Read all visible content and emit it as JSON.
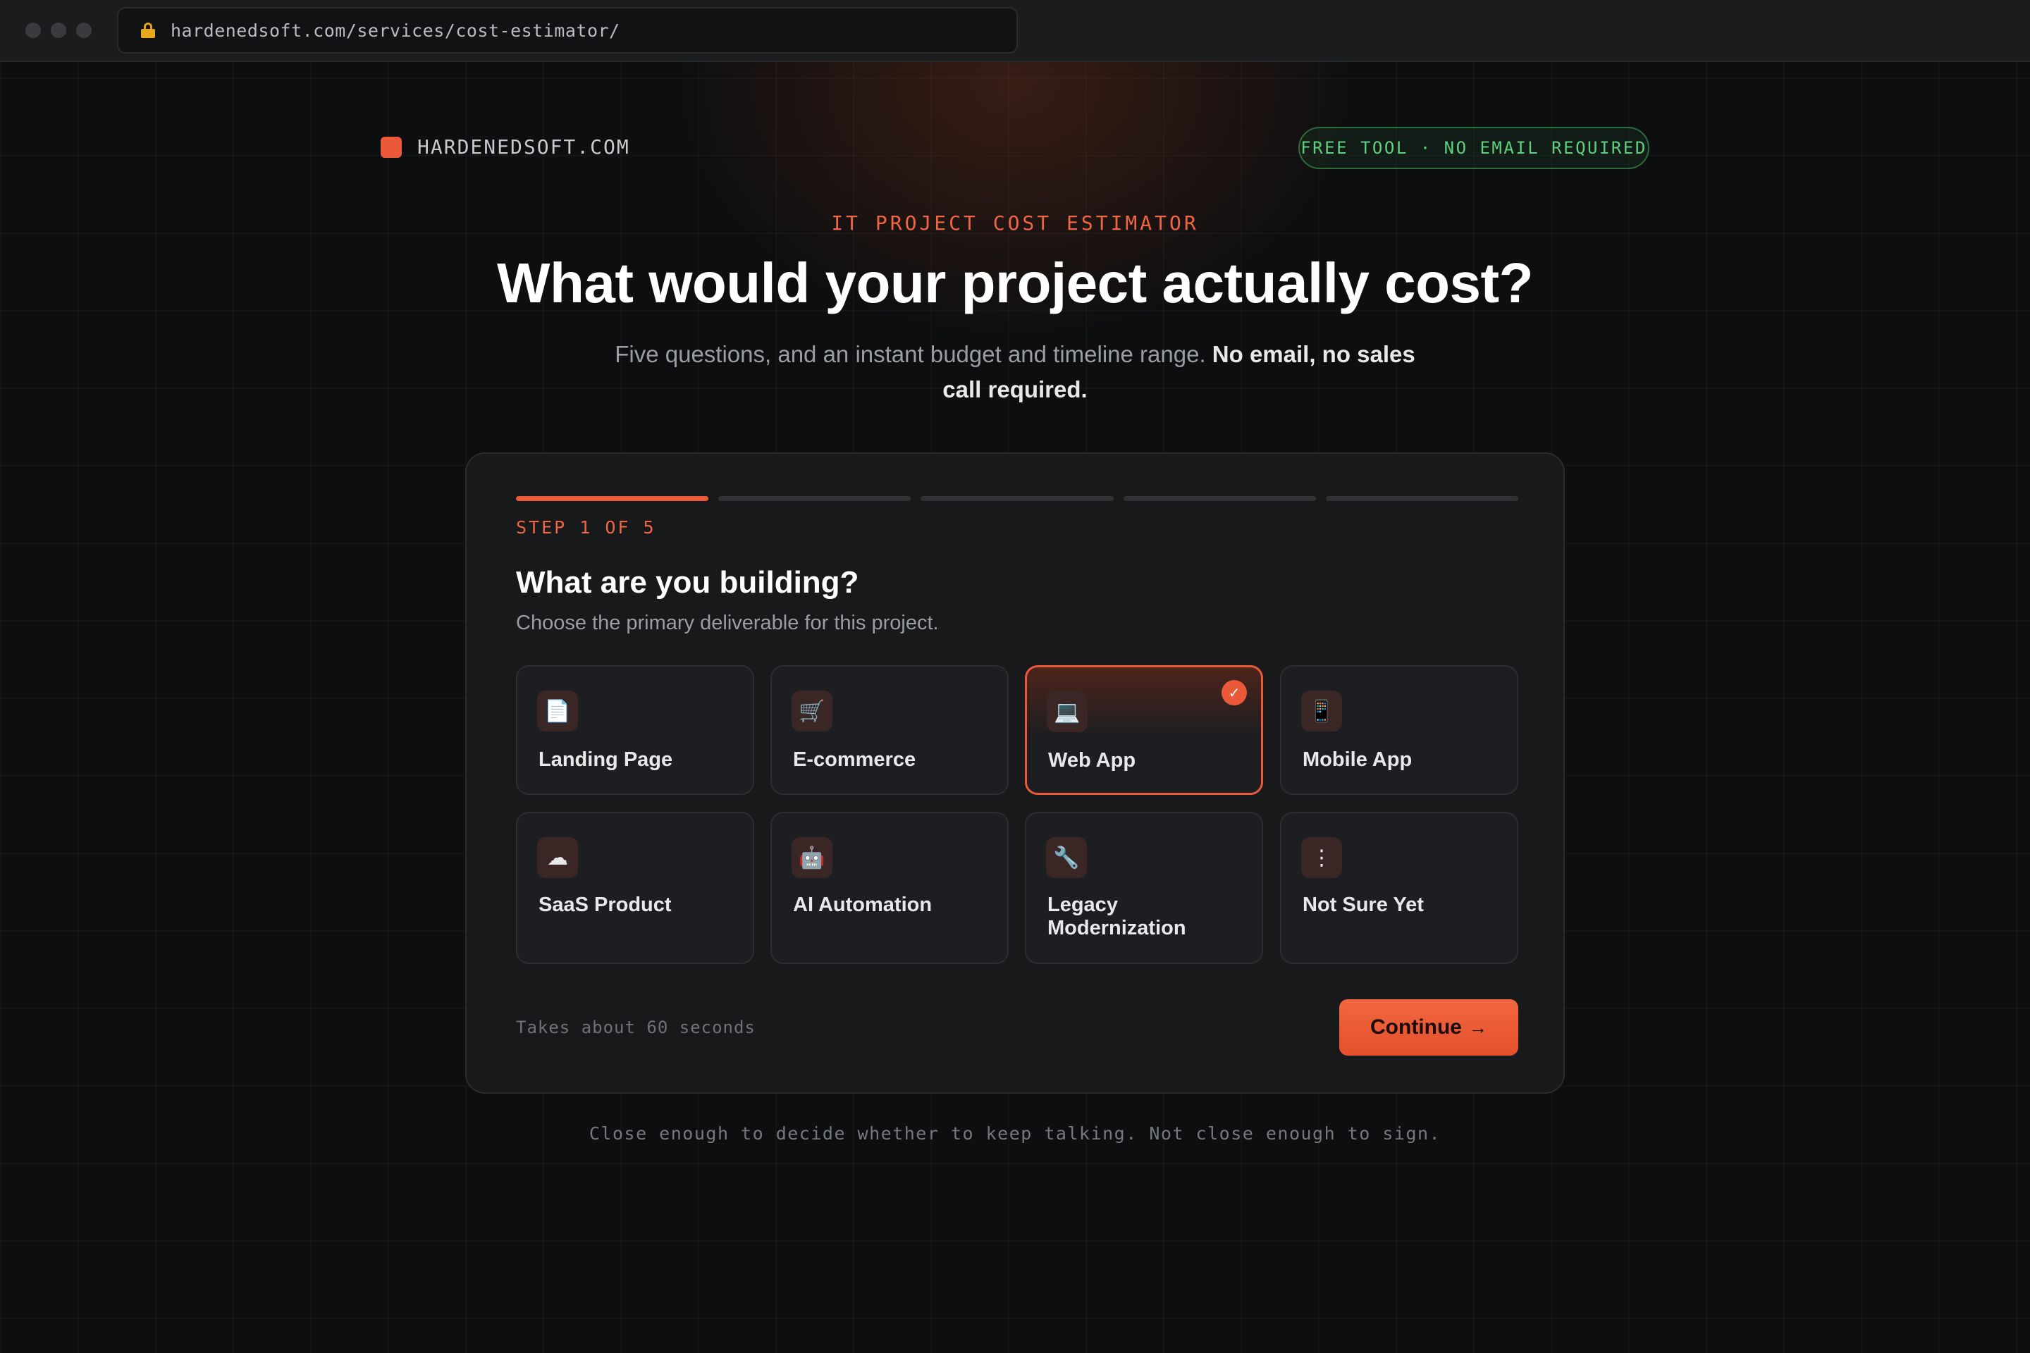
{
  "browser": {
    "url": "hardenedsoft.com/services/cost-estimator/"
  },
  "header": {
    "brand": "HARDENEDSOFT.COM",
    "badge": "FREE TOOL · NO EMAIL REQUIRED"
  },
  "hero": {
    "eyebrow": "IT PROJECT COST ESTIMATOR",
    "title": "What would your project actually cost?",
    "subtitle_plain": "Five questions, and an instant budget and timeline range. ",
    "subtitle_bold": "No email, no sales call required."
  },
  "wizard": {
    "step_label": "STEP 1 OF 5",
    "current_step": 1,
    "total_steps": 5,
    "question": "What are you building?",
    "helper": "Choose the primary deliverable for this project.",
    "options": [
      {
        "label": "Landing Page",
        "icon": "document-icon",
        "glyph": "📄",
        "selected": false
      },
      {
        "label": "E-commerce",
        "icon": "cart-icon",
        "glyph": "🛒",
        "selected": false
      },
      {
        "label": "Web App",
        "icon": "laptop-icon",
        "glyph": "💻",
        "selected": true
      },
      {
        "label": "Mobile App",
        "icon": "phone-icon",
        "glyph": "📱",
        "selected": false
      },
      {
        "label": "SaaS Product",
        "icon": "cloud-icon",
        "glyph": "☁",
        "selected": false
      },
      {
        "label": "AI Automation",
        "icon": "robot-icon",
        "glyph": "🤖",
        "selected": false
      },
      {
        "label": "Legacy\nModernization",
        "icon": "wrench-icon",
        "glyph": "🔧",
        "selected": false
      },
      {
        "label": "Not Sure Yet",
        "icon": "more-icon",
        "glyph": "⋮",
        "selected": false
      }
    ],
    "time_note": "Takes about 60 seconds",
    "continue_label": "Continue",
    "continue_arrow": "→"
  },
  "footer": {
    "note": "Close enough to decide whether to keep talking. Not close enough to sign."
  },
  "colors": {
    "accent": "#ea5a3a",
    "badge_green": "#5fd07d",
    "background": "#0d0e10",
    "card": "#18191b"
  }
}
